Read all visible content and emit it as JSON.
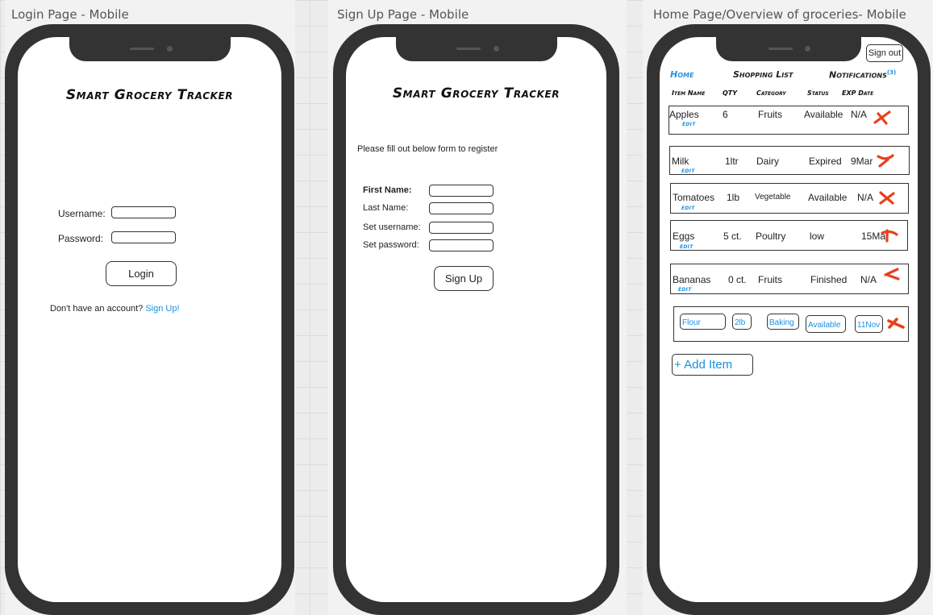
{
  "frames": {
    "login": {
      "label": "Login Page - Mobile"
    },
    "signup": {
      "label": "Sign Up Page - Mobile"
    },
    "home": {
      "label": "Home Page/Overview of groceries- Mobile"
    }
  },
  "login": {
    "title": "Smart Grocery Tracker",
    "username_label": "Username:",
    "password_label": "Password:",
    "login_button": "Login",
    "no_account_text": "Don't have an account?",
    "signup_link": "Sign Up!"
  },
  "signup": {
    "title": "Smart Grocery Tracker",
    "instructions": "Please fill out below form to register",
    "first_name_label": "First Name:",
    "last_name_label": "Last Name:",
    "set_username_label": "Set username:",
    "set_password_label": "Set password:",
    "signup_button": "Sign Up"
  },
  "home": {
    "signout_button": "Sign out",
    "nav": {
      "home": "Home",
      "shopping_list": "Shopping List",
      "notifications": "Notifications",
      "notifications_badge": "(3)"
    },
    "columns": [
      "Item Name",
      "QTY",
      "Category",
      "Status",
      "EXP Date"
    ],
    "edit_label": "EDIT",
    "items": [
      {
        "name": "Apples",
        "qty": "6",
        "category": "Fruits",
        "status": "Available",
        "exp": "N/A"
      },
      {
        "name": "Milk",
        "qty": "1ltr",
        "category": "Dairy",
        "status": "Expired",
        "exp": "9Mar"
      },
      {
        "name": "Tomatoes",
        "qty": "1lb",
        "category": "Vegetable",
        "status": "Available",
        "exp": "N/A"
      },
      {
        "name": "Eggs",
        "qty": "5 ct.",
        "category": "Poultry",
        "status": "low",
        "exp": "15Mar"
      },
      {
        "name": "Bananas",
        "qty": "0 ct.",
        "category": "Fruits",
        "status": "Finished",
        "exp": "N/A"
      }
    ],
    "editing_item": {
      "name": "Flour",
      "qty": "2lb",
      "category": "Baking",
      "status": "Available",
      "exp": "11Nov"
    },
    "add_item_button": "+ Add Item",
    "delete_icon_color": "#e8401c",
    "accent_color": "#1a90e0"
  }
}
